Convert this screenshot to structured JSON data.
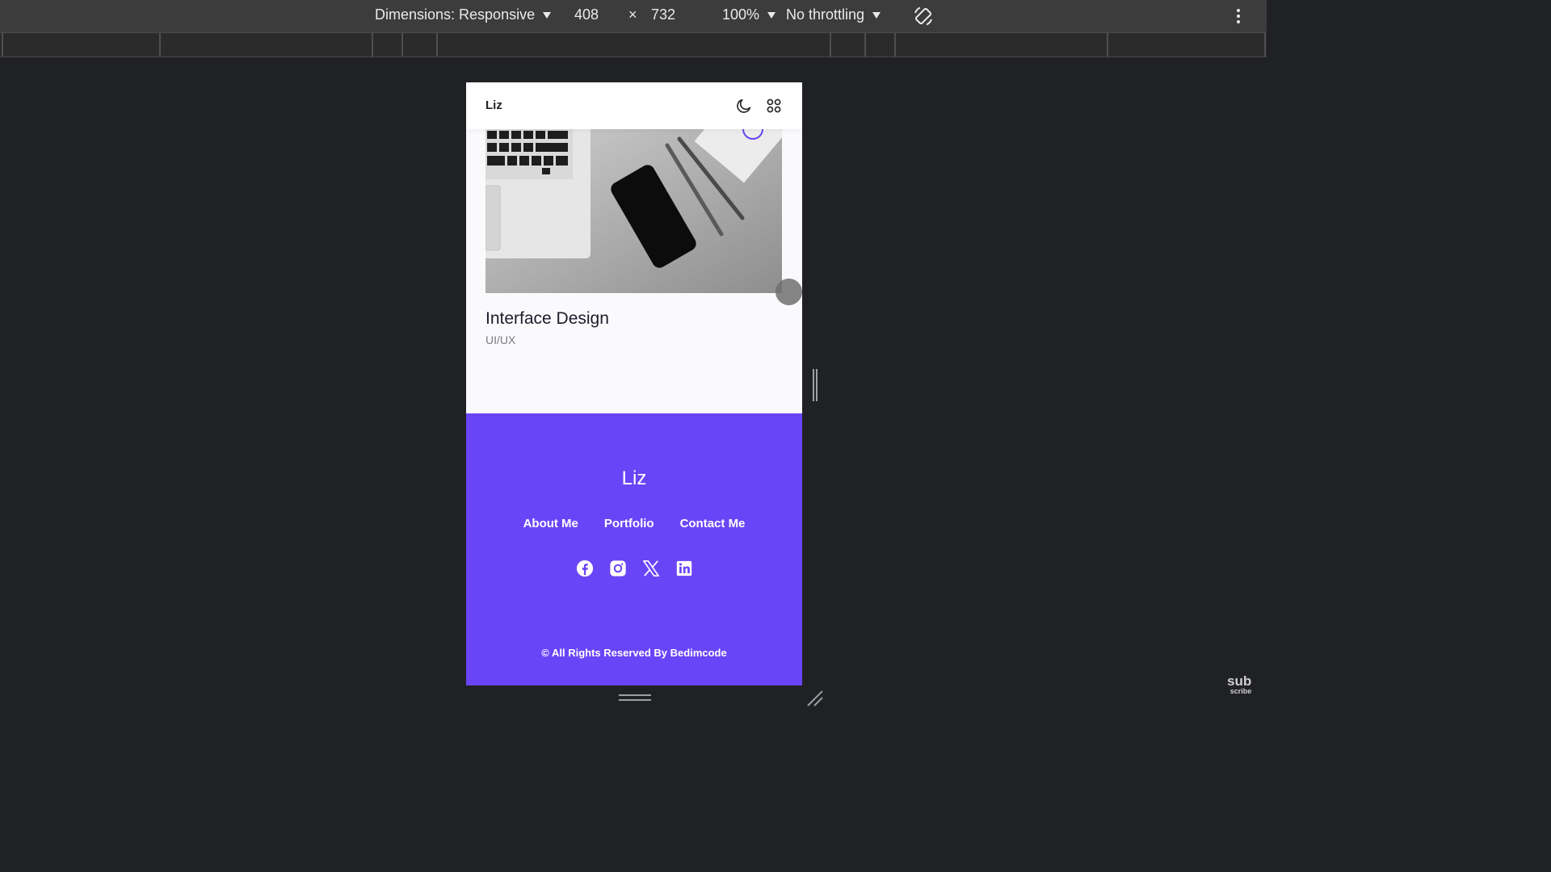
{
  "devtools": {
    "dimensions_label": "Dimensions: Responsive",
    "width": "408",
    "times": "×",
    "height": "732",
    "zoom": "100%",
    "throttling": "No throttling",
    "rotate_icon": "rotate-icon",
    "more_icon": "kebab-menu-icon"
  },
  "app": {
    "logo": "Liz",
    "theme_icon": "moon-icon",
    "menu_icon": "grid-icon"
  },
  "card": {
    "image_alt": "desk-photo",
    "title": "Interface Design",
    "subtitle": "UI/UX"
  },
  "footer": {
    "logo": "Liz",
    "links": [
      "About Me",
      "Portfolio",
      "Contact Me"
    ],
    "socials": [
      "facebook-icon",
      "instagram-icon",
      "x-icon",
      "linkedin-icon"
    ],
    "copyright": "© All Rights Reserved By Bedimcode"
  },
  "watermark": {
    "line1": "sub",
    "line2": "scribe"
  },
  "colors": {
    "accent": "#6a45f7",
    "toolbar": "#3c3c3c",
    "background": "#202124"
  }
}
